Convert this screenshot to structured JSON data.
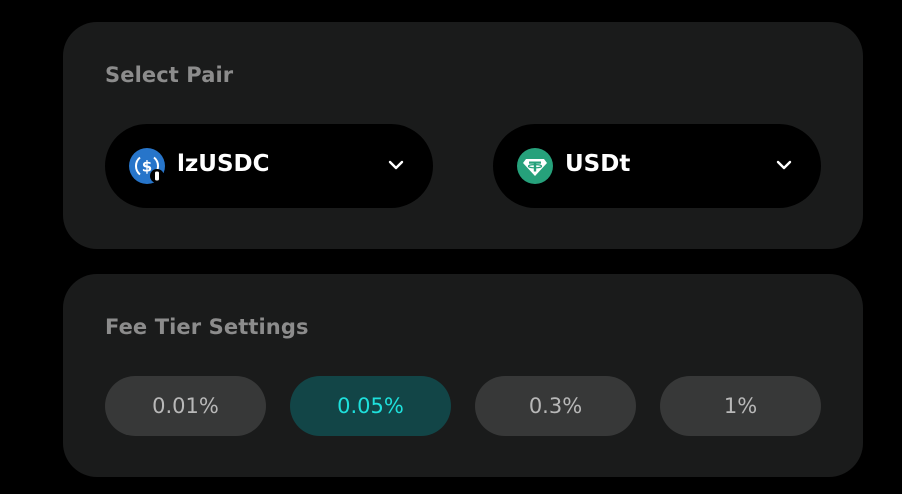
{
  "select_pair": {
    "title": "Select Pair",
    "token_a": {
      "symbol": "lzUSDC",
      "icon": "usdc-bridged-icon"
    },
    "token_b": {
      "symbol": "USDt",
      "icon": "tether-icon"
    }
  },
  "fee_tier": {
    "title": "Fee Tier Settings",
    "options": [
      {
        "label": "0.01%",
        "selected": false
      },
      {
        "label": "0.05%",
        "selected": true
      },
      {
        "label": "0.3%",
        "selected": false
      },
      {
        "label": "1%",
        "selected": false
      }
    ]
  },
  "colors": {
    "background": "#000000",
    "card": "#1a1b1b",
    "selected_fee_bg": "#124547",
    "selected_fee_text": "#1ee0dc",
    "usdc_blue": "#2775ca",
    "tether_teal": "#26a17b"
  }
}
